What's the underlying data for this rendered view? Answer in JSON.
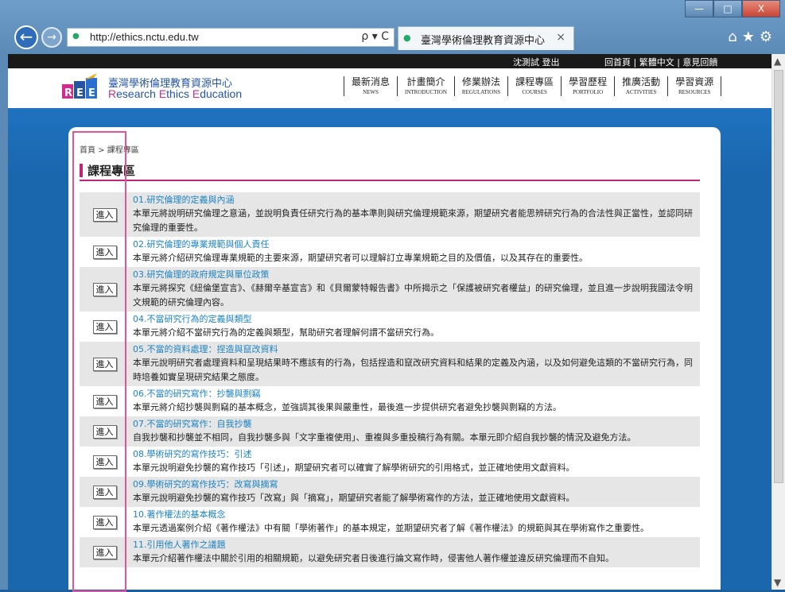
{
  "browser": {
    "url": "http://ethics.nctu.edu.tw",
    "tab_title": "臺灣學術倫理教育資源中心",
    "tab_close": "×",
    "addr_controls": "ρ ▾ C",
    "tools": "⌂★⚙",
    "win_buttons": [
      "—",
      "□",
      "X"
    ],
    "back": "←",
    "forward": "→"
  },
  "topbar": {
    "user": "沈測試  登出",
    "links": "回首頁 | 繁體中文 | 意見回饋"
  },
  "header": {
    "logo_cn": "臺灣學術倫理教育資源中心",
    "logo_en_r": "R",
    "logo_en_1": "esearch ",
    "logo_en_e": "E",
    "logo_en_2": "thics ",
    "logo_en_e2": "E",
    "logo_en_3": "ducation",
    "menu": [
      {
        "cn": "最新消息",
        "en": "NEWS"
      },
      {
        "cn": "計畫簡介",
        "en": "INTRODUCTION"
      },
      {
        "cn": "修業辦法",
        "en": "REGULATIONS"
      },
      {
        "cn": "課程專區",
        "en": "COURSES"
      },
      {
        "cn": "學習歷程",
        "en": "PORTFOLIO"
      },
      {
        "cn": "推廣活動",
        "en": "ACTIVITIES"
      },
      {
        "cn": "學習資源",
        "en": "RESOURCES"
      }
    ]
  },
  "breadcrumb": "首頁 > 課程專區",
  "section_title": "課程專區",
  "enter_label": "進入",
  "courses": [
    {
      "title": "01.研究倫理的定義與內涵",
      "desc": "本單元將說明研究倫理之意涵，並說明負責任研究行為的基本準則與研究倫理規範來源，期望研究者能思辨研究行為的合法性與正當性，並認同研究倫理的重要性。"
    },
    {
      "title": "02.研究倫理的專業規範與個人責任",
      "desc": "本單元將介紹研究倫理專業規範的主要來源，期望研究者可以理解訂立專業規範之目的及價值，以及其存在的重要性。"
    },
    {
      "title": "03.研究倫理的政府規定與單位政策",
      "desc": "本單元將探究《紐倫堡宣言》、《赫爾辛基宣言》和《貝爾蒙特報告書》中所揭示之「保護被研究者權益」的研究倫理，並且進一步說明我國法令明文規範的研究倫理內容。"
    },
    {
      "title": "04.不當研究行為的定義與類型",
      "desc": "本單元將介紹不當研究行為的定義與類型，幫助研究者理解何謂不當研究行為。"
    },
    {
      "title": "05.不當的資料處理：捏造與竄改資料",
      "desc": "本單元說明研究者處理資料和呈現結果時不應該有的行為，包括捏造和竄改研究資料和結果的定義及內涵，以及如何避免這類的不當研究行為，同時培養如實呈現研究結果之態度。"
    },
    {
      "title": "06.不當的研究寫作：抄襲與剽竊",
      "desc": "本單元將介紹抄襲與剽竊的基本概念，並強調其後果與嚴重性，最後進一步提供研究者避免抄襲與剽竊的方法。"
    },
    {
      "title": "07.不當的研究寫作：自我抄襲",
      "desc": "自我抄襲和抄襲並不相同，自我抄襲多與「文字重複使用」、重複與多重投稿行為有關。本單元即介紹自我抄襲的情況及避免方法。"
    },
    {
      "title": "08.學術研究的寫作技巧：引述",
      "desc": "本單元說明避免抄襲的寫作技巧「引述」，期望研究者可以確實了解學術研究的引用格式，並正確地使用文獻資料。"
    },
    {
      "title": "09.學術研究的寫作技巧：改寫與摘寫",
      "desc": "本單元說明避免抄襲的寫作技巧「改寫」與「摘寫」，期望研究者能了解學術寫作的方法，並正確地使用文獻資料。"
    },
    {
      "title": "10.著作權法的基本概念",
      "desc": "本單元透過案例介紹《著作權法》中有關「學術著作」的基本規定，並期望研究者了解《著作權法》的規範與其在學術寫作之重要性。"
    },
    {
      "title": "11.引用他人著作之議題",
      "desc": "本單元介紹著作權法中關於引用的相關規範，以避免研究者日後進行論文寫作時，侵害他人著作權並違反研究倫理而不自知。"
    }
  ],
  "colors": {
    "accent_pink": "#c2247a",
    "frame_pink": "#e0559a",
    "link_blue": "#1d83c2",
    "banner_blue": "#1b67ad"
  }
}
